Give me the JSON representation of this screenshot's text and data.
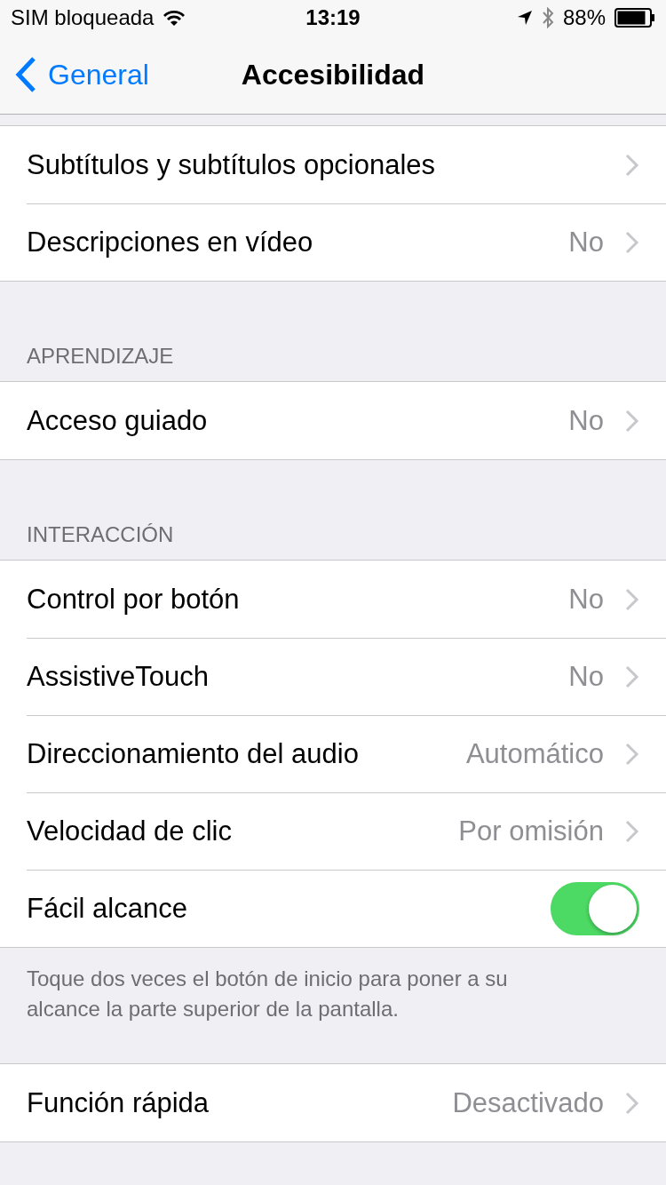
{
  "status_bar": {
    "carrier": "SIM bloqueada",
    "time": "13:19",
    "battery": "88%"
  },
  "nav": {
    "back": "General",
    "title": "Accesibilidad"
  },
  "sections": [
    {
      "rows": [
        {
          "kind": "link",
          "label": "Subtítulos y subtítulos opcionales"
        },
        {
          "kind": "link",
          "label": "Descripciones en vídeo",
          "value": "No"
        }
      ]
    },
    {
      "header": "APRENDIZAJE",
      "rows": [
        {
          "kind": "link",
          "label": "Acceso guiado",
          "value": "No"
        }
      ]
    },
    {
      "header": "INTERACCIÓN",
      "rows": [
        {
          "kind": "link",
          "label": "Control por botón",
          "value": "No"
        },
        {
          "kind": "link",
          "label": "AssistiveTouch",
          "value": "No"
        },
        {
          "kind": "link",
          "label": "Direccionamiento del audio",
          "value": "Automático"
        },
        {
          "kind": "link",
          "label": "Velocidad de clic",
          "value": "Por omisión"
        },
        {
          "kind": "toggle",
          "label": "Fácil alcance",
          "on": true
        }
      ],
      "footer": "Toque dos veces el botón de inicio para poner a su alcance la parte superior de la pantalla."
    },
    {
      "rows": [
        {
          "kind": "link",
          "label": "Función rápida",
          "value": "Desactivado"
        }
      ]
    }
  ]
}
